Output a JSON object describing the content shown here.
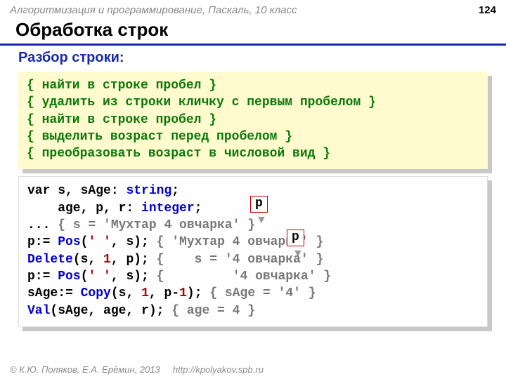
{
  "header": {
    "breadcrumb": "Алгоритмизация и программирование, Паскаль, 10 класс",
    "page_number": "124"
  },
  "title": "Обработка строк",
  "subtitle": "Разбор строки:",
  "algorithm_comments": {
    "l1": "{ найти в строке пробел }",
    "l2": "{ удалить из строки кличку с первым пробелом }",
    "l3": "{ найти в строке пробел }",
    "l4": "{ выделить возраст перед пробелом }",
    "l5": "{ преобразовать возраст в числовой вид }"
  },
  "code": {
    "l1a": "var s, sAge: ",
    "l1b": "string",
    "l1c": ";",
    "l2a": "    age, p, r: ",
    "l2b": "integer",
    "l2c": ";",
    "l3a": "... ",
    "l3b": "{ s = 'Мухтар 4 овчарка' }",
    "l4a": "p:= ",
    "l4b": "Pos",
    "l4c": "(",
    "l4d": "' '",
    "l4e": ", s); ",
    "l4f": "{ 'Мухтар 4 овчарка' }",
    "l5a": "Delete",
    "l5b": "(s, ",
    "l5c": "1",
    "l5d": ", p); ",
    "l5e": "{    s = '4 овчарка' }",
    "l6a": "p:= ",
    "l6b": "Pos",
    "l6c": "(",
    "l6d": "' '",
    "l6e": ", s); ",
    "l6f": "{         '4 овчарка' }",
    "l7a": "sAge:= ",
    "l7b": "Copy",
    "l7c": "(s, ",
    "l7d": "1",
    "l7e": ", p-",
    "l7f": "1",
    "l7g": "); ",
    "l7h": "{ sAge = '4' }",
    "l8a": "Val",
    "l8b": "(sAge, age, r); ",
    "l8c": "{ age = 4 }"
  },
  "overlay": {
    "ptag1": "p",
    "ptag2": "p"
  },
  "footer": {
    "left": "© К.Ю. Поляков, Е.А. Ерёмин, 2013",
    "right": "http://kpolyakov.spb.ru"
  }
}
